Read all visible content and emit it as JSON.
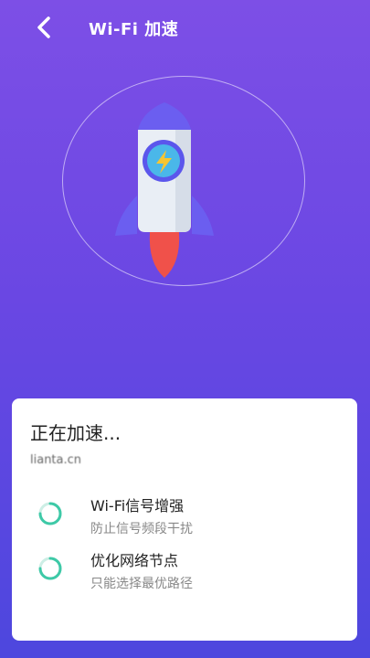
{
  "header": {
    "back_icon": "back-arrow-icon",
    "title": "Wi-Fi 加速"
  },
  "hero": {
    "icon": "rocket-icon",
    "badge_icon": "lightning-icon"
  },
  "card": {
    "title": "正在加速...",
    "url": "lianta.cn",
    "tasks": [
      {
        "name": "Wi-Fi信号增强",
        "desc": "防止信号频段干扰",
        "status_icon": "loading-spinner-icon"
      },
      {
        "name": "优化网络节点",
        "desc": "只能选择最优路径",
        "status_icon": "loading-spinner-icon"
      }
    ]
  },
  "colors": {
    "bg_top": "#7d4fe6",
    "bg_bottom": "#4d47de",
    "spinner": "#3ec9a7",
    "flame": "#f0514a"
  }
}
